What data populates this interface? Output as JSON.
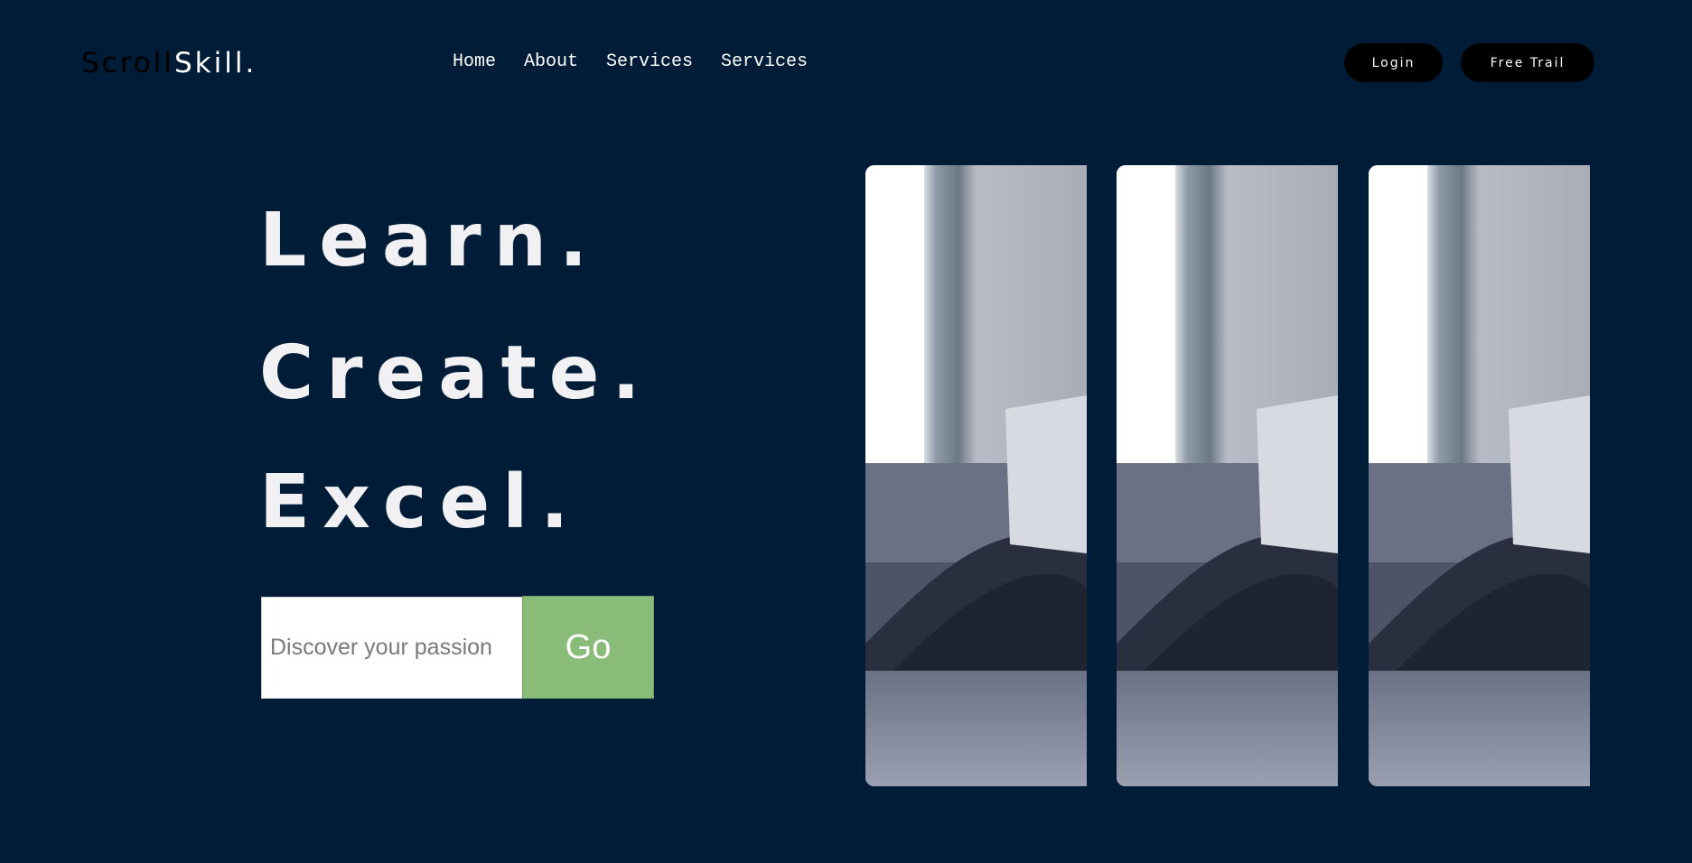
{
  "header": {
    "logo_part1": "Scroll",
    "logo_part2": "Skill.",
    "nav": [
      "Home",
      "About",
      "Services",
      "Services"
    ],
    "login_label": "Login",
    "trial_label": "Free Trail"
  },
  "hero": {
    "line1": "Learn.",
    "line2": "Create.",
    "line3": "Excel."
  },
  "search": {
    "placeholder": "Discover your passion",
    "button_label": "Go"
  },
  "gallery": {
    "image_count": 3,
    "image_subject": "person-with-laptop-on-sofa"
  },
  "colors": {
    "background": "#001c36",
    "accent_green": "#8abc79",
    "button_black": "#000000",
    "hero_text": "#f1f1f3"
  }
}
